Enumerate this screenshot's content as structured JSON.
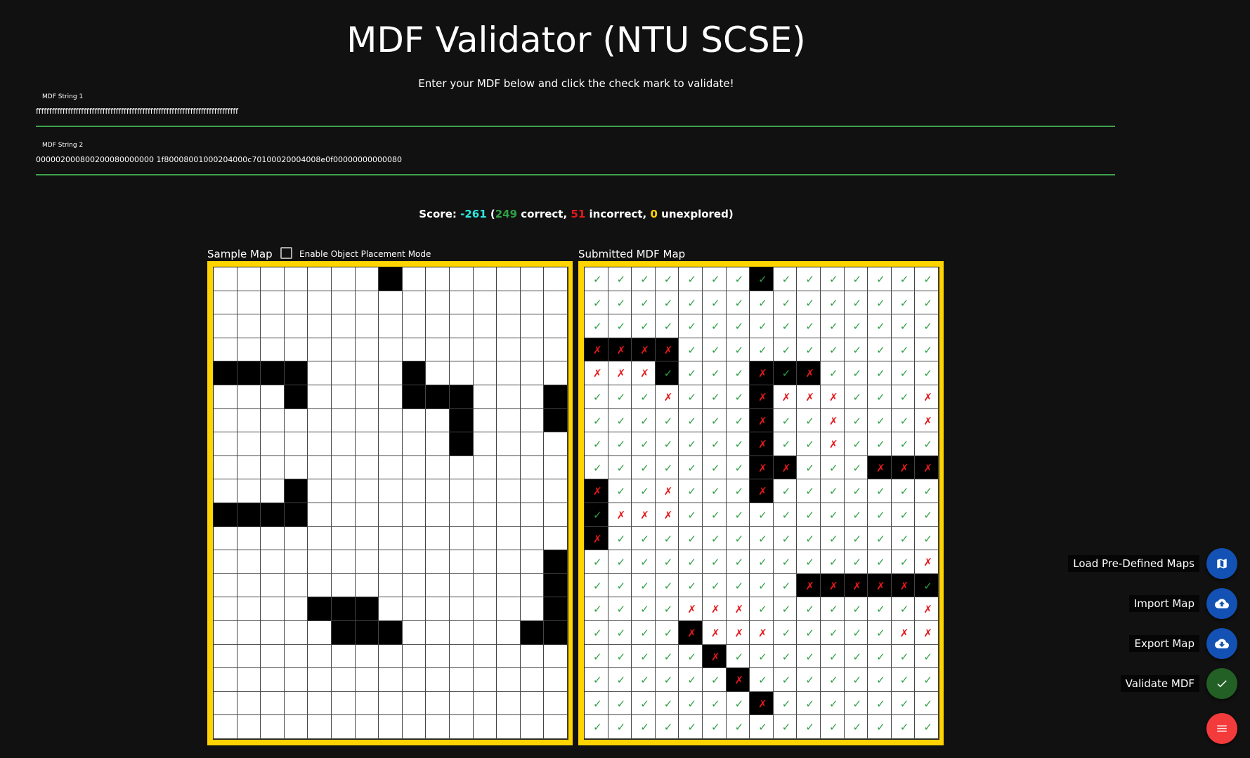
{
  "title": "MDF Validator (NTU SCSE)",
  "subtitle": "Enter your MDF below and click the check mark to validate!",
  "fields": [
    {
      "label": "MDF String 1",
      "value": "ffffffffffffffffffffffffffffffffffffffffffffffffffffffffffffffffffffffffffff"
    },
    {
      "label": "MDF String 2",
      "value": "000002000800200080000000 1f80008001000204000c70100020004008e0f00000000000080"
    }
  ],
  "score": {
    "prefix": "Score: ",
    "value": "-261",
    "open": " (",
    "correct": "249",
    "correct_label": " correct, ",
    "incorrect": "51",
    "incorrect_label": " incorrect, ",
    "unexplored": "0",
    "unexplored_label": " unexplored)"
  },
  "sample_map": {
    "title": "Sample Map",
    "placement_label": "Enable Object Placement Mode",
    "obstacles": [
      [
        0,
        7
      ],
      [
        4,
        0
      ],
      [
        4,
        1
      ],
      [
        4,
        2
      ],
      [
        4,
        3
      ],
      [
        4,
        8
      ],
      [
        5,
        3
      ],
      [
        5,
        8
      ],
      [
        5,
        9
      ],
      [
        5,
        10
      ],
      [
        5,
        14
      ],
      [
        6,
        10
      ],
      [
        6,
        14
      ],
      [
        7,
        10
      ],
      [
        9,
        3
      ],
      [
        10,
        0
      ],
      [
        10,
        1
      ],
      [
        10,
        2
      ],
      [
        10,
        3
      ],
      [
        12,
        14
      ],
      [
        13,
        14
      ],
      [
        14,
        4
      ],
      [
        14,
        5
      ],
      [
        14,
        6
      ],
      [
        14,
        14
      ],
      [
        15,
        5
      ],
      [
        15,
        6
      ],
      [
        15,
        7
      ],
      [
        15,
        13
      ],
      [
        15,
        14
      ]
    ]
  },
  "submitted_map": {
    "title": "Submitted MDF Map",
    "obstacles": [
      [
        0,
        7
      ],
      [
        3,
        0
      ],
      [
        3,
        1
      ],
      [
        3,
        2
      ],
      [
        3,
        3
      ],
      [
        4,
        3
      ],
      [
        4,
        7
      ],
      [
        4,
        8
      ],
      [
        4,
        9
      ],
      [
        5,
        7
      ],
      [
        6,
        7
      ],
      [
        7,
        7
      ],
      [
        8,
        7
      ],
      [
        8,
        8
      ],
      [
        8,
        12
      ],
      [
        8,
        13
      ],
      [
        8,
        14
      ],
      [
        9,
        0
      ],
      [
        9,
        7
      ],
      [
        10,
        0
      ],
      [
        11,
        0
      ],
      [
        13,
        9
      ],
      [
        13,
        10
      ],
      [
        13,
        11
      ],
      [
        13,
        12
      ],
      [
        13,
        13
      ],
      [
        13,
        14
      ],
      [
        15,
        4
      ],
      [
        16,
        5
      ],
      [
        17,
        6
      ],
      [
        18,
        7
      ]
    ],
    "incorrect": [
      [
        3,
        0
      ],
      [
        3,
        1
      ],
      [
        3,
        2
      ],
      [
        3,
        3
      ],
      [
        4,
        0
      ],
      [
        4,
        1
      ],
      [
        4,
        2
      ],
      [
        4,
        7
      ],
      [
        4,
        9
      ],
      [
        5,
        3
      ],
      [
        5,
        7
      ],
      [
        5,
        8
      ],
      [
        5,
        9
      ],
      [
        5,
        10
      ],
      [
        5,
        14
      ],
      [
        6,
        7
      ],
      [
        6,
        10
      ],
      [
        6,
        14
      ],
      [
        7,
        7
      ],
      [
        7,
        10
      ],
      [
        8,
        7
      ],
      [
        8,
        8
      ],
      [
        8,
        12
      ],
      [
        8,
        13
      ],
      [
        8,
        14
      ],
      [
        9,
        0
      ],
      [
        9,
        3
      ],
      [
        9,
        7
      ],
      [
        10,
        1
      ],
      [
        10,
        2
      ],
      [
        10,
        3
      ],
      [
        11,
        0
      ],
      [
        12,
        14
      ],
      [
        13,
        9
      ],
      [
        13,
        10
      ],
      [
        13,
        11
      ],
      [
        13,
        12
      ],
      [
        13,
        13
      ],
      [
        14,
        4
      ],
      [
        14,
        5
      ],
      [
        14,
        6
      ],
      [
        14,
        14
      ],
      [
        15,
        4
      ],
      [
        15,
        5
      ],
      [
        15,
        6
      ],
      [
        15,
        7
      ],
      [
        15,
        13
      ],
      [
        15,
        14
      ],
      [
        16,
        5
      ],
      [
        17,
        6
      ],
      [
        18,
        7
      ]
    ]
  },
  "actions": [
    {
      "label": "Load Pre-Defined Maps",
      "icon": "map-icon"
    },
    {
      "label": "Import Map",
      "icon": "cloud-upload-icon"
    },
    {
      "label": "Export Map",
      "icon": "cloud-download-icon"
    },
    {
      "label": "Validate MDF",
      "icon": "check-icon"
    }
  ],
  "menu_icon": "menu-icon",
  "colors": {
    "correct": "#2ea043",
    "incorrect": "#e5191b",
    "unexplored": "#ffd400",
    "score": "#2ee8e0",
    "frame": "#ffd400",
    "underline": "#3fa34d"
  }
}
